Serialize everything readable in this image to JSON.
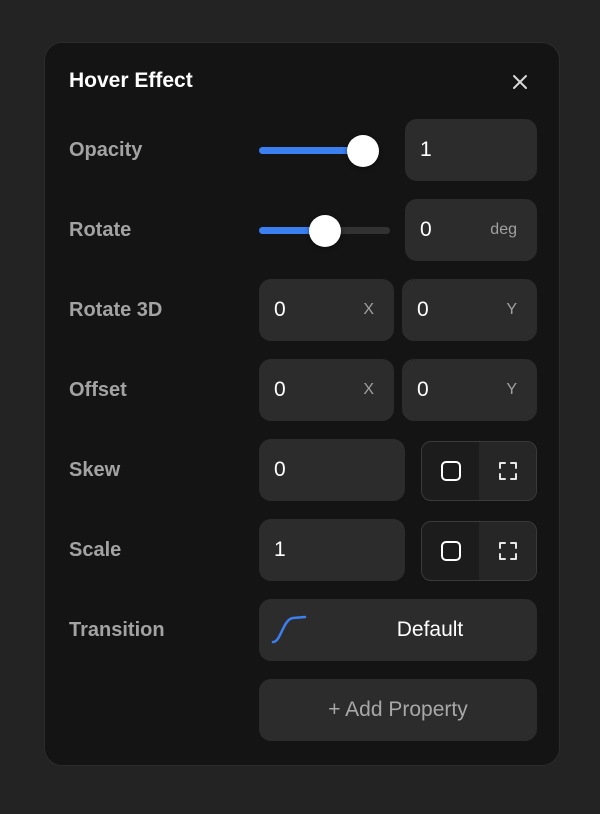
{
  "panel": {
    "title": "Hover Effect"
  },
  "opacity": {
    "label": "Opacity",
    "value": "1",
    "slider_level": 0.9
  },
  "rotate": {
    "label": "Rotate",
    "value": "0",
    "unit": "deg",
    "slider_level": 0.5
  },
  "rotate3d": {
    "label": "Rotate 3D",
    "x_value": "0",
    "x_unit": "X",
    "y_value": "0",
    "y_unit": "Y"
  },
  "offset": {
    "label": "Offset",
    "x_value": "0",
    "x_unit": "X",
    "y_value": "0",
    "y_unit": "Y"
  },
  "skew": {
    "label": "Skew",
    "value": "0",
    "toggle_icons": [
      "square-icon",
      "expand-corners-icon"
    ]
  },
  "scale": {
    "label": "Scale",
    "value": "1",
    "toggle_icons": [
      "square-icon",
      "expand-corners-icon"
    ]
  },
  "transition": {
    "label": "Transition",
    "value": "Default",
    "icon": "ease-curve-icon"
  },
  "add_property": {
    "label": "+ Add Property"
  },
  "colors": {
    "accent": "#3b7ff0",
    "panel_bg": "#141414",
    "field_bg": "#2c2c2c"
  }
}
